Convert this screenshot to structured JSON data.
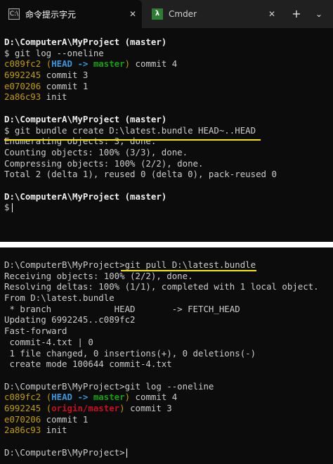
{
  "tabs": [
    {
      "label": "命令提示字元",
      "close": "✕",
      "icon": "cmd-icon",
      "active": true
    },
    {
      "label": "Cmder",
      "close": "✕",
      "icon": "lambda-icon",
      "icon_glyph": "λ",
      "active": false
    }
  ],
  "titlebar": {
    "new_tab": "+",
    "dropdown": "⌄"
  },
  "terminal_a": {
    "prompt1": "D:\\ComputerA\\MyProject (master)",
    "cmd1": "$ git log --oneline",
    "log1": [
      {
        "hash": "c089fc2",
        "head": "HEAD -> ",
        "branch": "master",
        "msg": " commit 4"
      },
      {
        "hash": "6992245",
        "msg": " commit 3"
      },
      {
        "hash": "e070206",
        "msg": " commit 1"
      },
      {
        "hash": "2a86c93",
        "msg": " init"
      }
    ],
    "prompt2": "D:\\ComputerA\\MyProject (master)",
    "cmd2": "$ git bundle create D:\\latest.bundle HEAD~..HEAD",
    "out2": [
      "Enumerating objects: 3, done.",
      "Counting objects: 100% (3/3), done.",
      "Compressing objects: 100% (2/2), done.",
      "Total 2 (delta 1), reused 0 (delta 0), pack-reused 0"
    ],
    "prompt3": "D:\\ComputerA\\MyProject (master)",
    "cmd3": "$"
  },
  "terminal_b": {
    "prompt_pull": "D:\\ComputerB\\MyProject>",
    "cmd_pull": "git pull D:\\latest.bundle",
    "pull_out": [
      "Receiving objects: 100% (2/2), done.",
      "Resolving deltas: 100% (1/1), completed with 1 local object.",
      "From D:\\latest.bundle",
      " * branch            HEAD       -> FETCH_HEAD",
      "Updating 6992245..c089fc2",
      "Fast-forward",
      " commit-4.txt | 0",
      " 1 file changed, 0 insertions(+), 0 deletions(-)",
      " create mode 100644 commit-4.txt"
    ],
    "prompt_log": "D:\\ComputerB\\MyProject>",
    "cmd_log": "git log --oneline",
    "log": [
      {
        "hash": "c089fc2",
        "head": "HEAD -> ",
        "branch": "master",
        "msg": " commit 4"
      },
      {
        "hash": "6992245",
        "branch": "origin/master",
        "msg": " commit 3"
      },
      {
        "hash": "e070206",
        "msg": " commit 1"
      },
      {
        "hash": "2a86c93",
        "msg": " init"
      }
    ],
    "prompt_end": "D:\\ComputerB\\MyProject>"
  },
  "colors": {
    "highlight_underline": "#ffe600",
    "hash": "#c19c00",
    "head": "#3a96dd",
    "local_branch": "#13a10e",
    "remote_branch": "#c50f1f"
  }
}
